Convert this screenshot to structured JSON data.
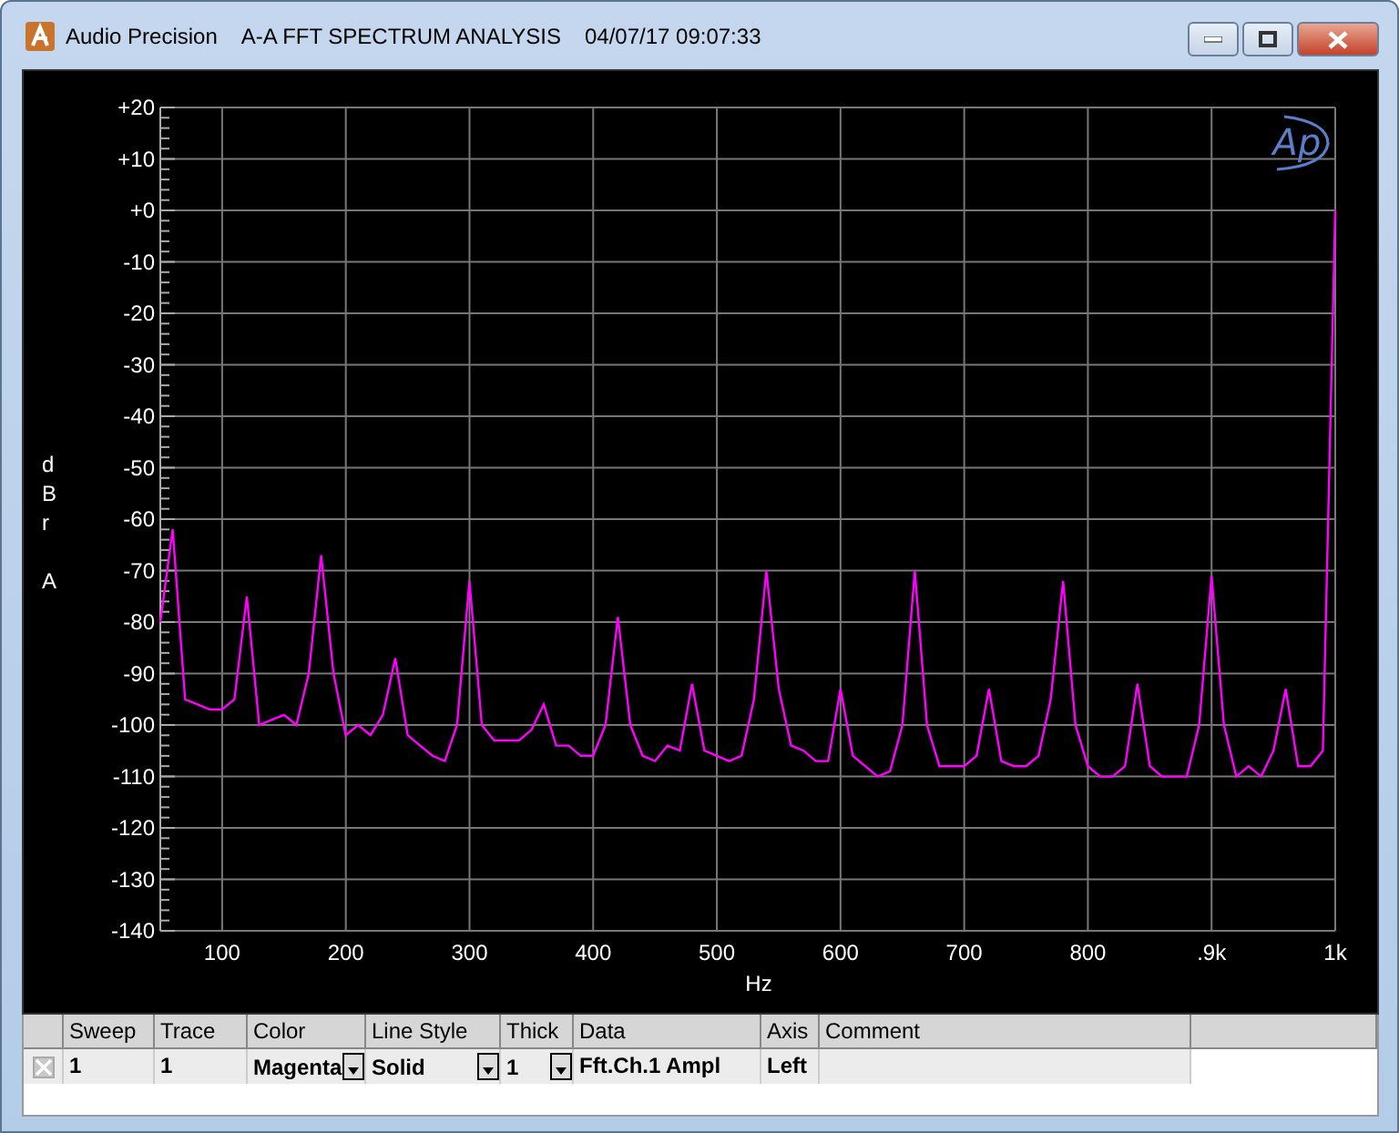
{
  "window": {
    "title_parts": [
      "Audio Precision",
      "A-A FFT SPECTRUM ANALYSIS",
      "04/07/17 09:07:33"
    ]
  },
  "graph": {
    "logo": "Ap",
    "chart_data": {
      "type": "line",
      "xlabel": "Hz",
      "ylabel": "dBr A",
      "xlim": [
        50,
        1000
      ],
      "ylim": [
        -140,
        20
      ],
      "xticks": [
        {
          "value": 100,
          "label": "100"
        },
        {
          "value": 200,
          "label": "200"
        },
        {
          "value": 300,
          "label": "300"
        },
        {
          "value": 400,
          "label": "400"
        },
        {
          "value": 500,
          "label": "500"
        },
        {
          "value": 600,
          "label": "600"
        },
        {
          "value": 700,
          "label": "700"
        },
        {
          "value": 800,
          "label": "800"
        },
        {
          "value": 900,
          "label": ".9k"
        },
        {
          "value": 1000,
          "label": "1k"
        }
      ],
      "yticks": [
        {
          "value": 20,
          "label": "+20"
        },
        {
          "value": 10,
          "label": "+10"
        },
        {
          "value": 0,
          "label": "+0"
        },
        -10,
        -20,
        -30,
        -40,
        -50,
        -60,
        -70,
        -80,
        -90,
        -100,
        -110,
        -120,
        -130,
        -140
      ],
      "x": [
        50,
        60,
        70,
        80,
        90,
        100,
        110,
        120,
        130,
        140,
        150,
        160,
        170,
        180,
        190,
        200,
        210,
        220,
        230,
        240,
        250,
        260,
        270,
        280,
        290,
        300,
        310,
        320,
        330,
        340,
        350,
        360,
        370,
        380,
        390,
        400,
        410,
        420,
        430,
        440,
        450,
        460,
        470,
        480,
        490,
        500,
        510,
        520,
        530,
        540,
        550,
        560,
        570,
        580,
        590,
        600,
        610,
        620,
        630,
        640,
        650,
        660,
        670,
        680,
        690,
        700,
        710,
        720,
        730,
        740,
        750,
        760,
        770,
        780,
        790,
        800,
        810,
        820,
        830,
        840,
        850,
        860,
        870,
        880,
        890,
        900,
        910,
        920,
        930,
        940,
        950,
        960,
        970,
        980,
        990,
        1000
      ],
      "grid": true,
      "series": [
        {
          "color": "#ff00ff",
          "values": [
            -80,
            -62,
            -95,
            -96,
            -97,
            -97,
            -95,
            -75,
            -100,
            -99,
            -98,
            -100,
            -90,
            -67,
            -90,
            -102,
            -100,
            -102,
            -98,
            -87,
            -102,
            -104,
            -106,
            -107,
            -100,
            -72,
            -100,
            -103,
            -103,
            -103,
            -101,
            -96,
            -104,
            -104,
            -106,
            -106,
            -100,
            -79,
            -100,
            -106,
            -107,
            -104,
            -105,
            -92,
            -105,
            -106,
            -107,
            -106,
            -95,
            -70,
            -93,
            -104,
            -105,
            -107,
            -107,
            -93,
            -106,
            -108,
            -110,
            -109,
            -100,
            -70,
            -100,
            -108,
            -108,
            -108,
            -106,
            -93,
            -107,
            -108,
            -108,
            -106,
            -95,
            -72,
            -100,
            -108,
            -110,
            -110,
            -108,
            -92,
            -108,
            -110,
            -110,
            -110,
            -100,
            -71,
            -100,
            -110,
            -108,
            -110,
            -105,
            -93,
            -108,
            -108,
            -105,
            0
          ]
        }
      ]
    }
  },
  "table": {
    "columns": [
      "Sweep",
      "Trace",
      "Color",
      "Line Style",
      "Thick",
      "Data",
      "Axis",
      "Comment"
    ],
    "rows": [
      {
        "cells": [
          {
            "text": "1",
            "kind": "text"
          },
          {
            "text": "1",
            "kind": "text"
          },
          {
            "text": "Magenta",
            "kind": "dropdown"
          },
          {
            "text": "Solid",
            "kind": "dropdown"
          },
          {
            "text": "1",
            "kind": "dropdown"
          },
          {
            "text": "Fft.Ch.1 Ampl",
            "kind": "text"
          },
          {
            "text": "Left",
            "kind": "text"
          },
          {
            "text": "",
            "kind": "text"
          }
        ]
      }
    ]
  }
}
